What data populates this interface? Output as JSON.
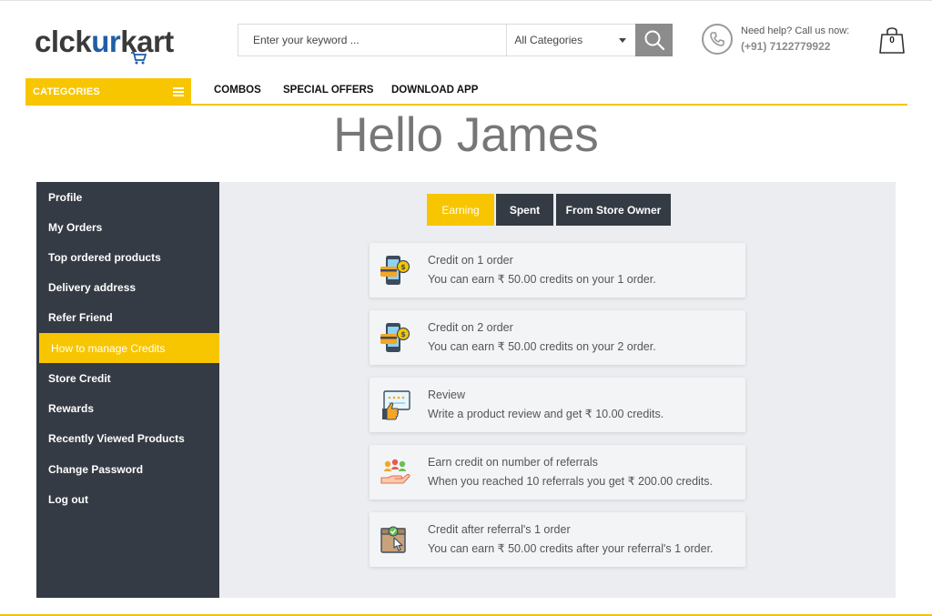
{
  "brand": {
    "logo_part1": "cl",
    "logo_part2": "ck",
    "logo_part3": "ur",
    "logo_part4": "kart",
    "logo_colors": {
      "dark": "#3a3a3a",
      "blue": "#1f5fa6"
    }
  },
  "search": {
    "placeholder": "Enter your keyword ...",
    "category_selected": "All Categories",
    "button_icon": "search-icon"
  },
  "help": {
    "label": "Need help? Call us now:",
    "phone": "(+91) 7122779922",
    "icon": "phone-icon"
  },
  "cart": {
    "count": "0",
    "icon": "shopping-bag-icon"
  },
  "nav": {
    "categories_label": "CATEGORIES",
    "links": [
      "COMBOS",
      "SPECIAL OFFERS",
      "DOWNLOAD APP"
    ]
  },
  "greeting": "Hello James",
  "sidebar": {
    "items": [
      {
        "label": "Profile"
      },
      {
        "label": "My Orders"
      },
      {
        "label": "Top ordered products"
      },
      {
        "label": "Delivery address"
      },
      {
        "label": "Refer Friend"
      },
      {
        "label": "How to manage Credits",
        "active": true
      },
      {
        "label": "Store Credit"
      },
      {
        "label": "Rewards"
      },
      {
        "label": "Recently Viewed Products"
      },
      {
        "label": "Change Password"
      },
      {
        "label": "Log out"
      }
    ]
  },
  "tabs": {
    "earning": "Earning",
    "spent": "Spent",
    "owner": "From Store Owner",
    "active": "Earning"
  },
  "cards": [
    {
      "icon": "mobile-payment-icon",
      "title": "Credit on 1 order",
      "desc": "You can earn ₹ 50.00 credits on your 1 order."
    },
    {
      "icon": "mobile-payment-icon",
      "title": "Credit on 2 order",
      "desc": "You can earn ₹ 50.00 credits on your 2 order."
    },
    {
      "icon": "review-icon",
      "title": "Review",
      "desc": "Write a product review and get ₹ 10.00 credits."
    },
    {
      "icon": "referral-hand-icon",
      "title": "Earn credit on number of referrals",
      "desc": "When you reached 10 referrals you get ₹ 200.00 credits."
    },
    {
      "icon": "box-click-icon",
      "title": "Credit after referral's 1 order",
      "desc": "You can earn ₹ 50.00 credits after your referral's 1 order."
    }
  ],
  "colors": {
    "accent": "#f7c600",
    "sidebar_bg": "#353b44",
    "panel_bg": "#ebedf0"
  }
}
